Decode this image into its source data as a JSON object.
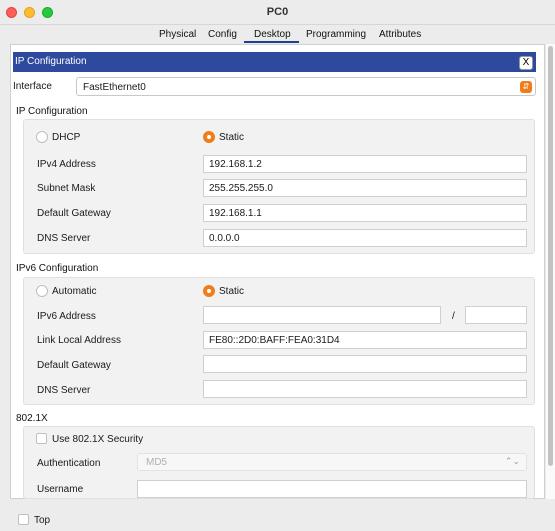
{
  "window": {
    "title": "PC0"
  },
  "tabs": [
    "Physical",
    "Config",
    "Desktop",
    "Programming",
    "Attributes"
  ],
  "active_tab": "Desktop",
  "panel": {
    "title": "IP Configuration",
    "close_label": "X"
  },
  "interface": {
    "label": "Interface",
    "value": "FastEthernet0"
  },
  "ipv4": {
    "heading": "IP Configuration",
    "dhcp_label": "DHCP",
    "static_label": "Static",
    "mode": "Static",
    "address_label": "IPv4 Address",
    "address": "192.168.1.2",
    "mask_label": "Subnet Mask",
    "mask": "255.255.255.0",
    "gateway_label": "Default Gateway",
    "gateway": "192.168.1.1",
    "dns_label": "DNS Server",
    "dns": "0.0.0.0"
  },
  "ipv6": {
    "heading": "IPv6 Configuration",
    "auto_label": "Automatic",
    "static_label": "Static",
    "mode": "Static",
    "address_label": "IPv6 Address",
    "address": "",
    "prefix_sep": "/",
    "prefix": "",
    "link_local_label": "Link Local Address",
    "link_local": "FE80::2D0:BAFF:FEA0:31D4",
    "gateway_label": "Default Gateway",
    "gateway": "",
    "dns_label": "DNS Server",
    "dns": ""
  },
  "dot1x": {
    "heading": "802.1X",
    "use_label": "Use 802.1X Security",
    "auth_label": "Authentication",
    "auth_value": "MD5",
    "username_label": "Username",
    "username": ""
  },
  "footer": {
    "top_label": "Top"
  },
  "colors": {
    "accent": "#ef7d1a",
    "header_bar": "#2e4a9e"
  }
}
